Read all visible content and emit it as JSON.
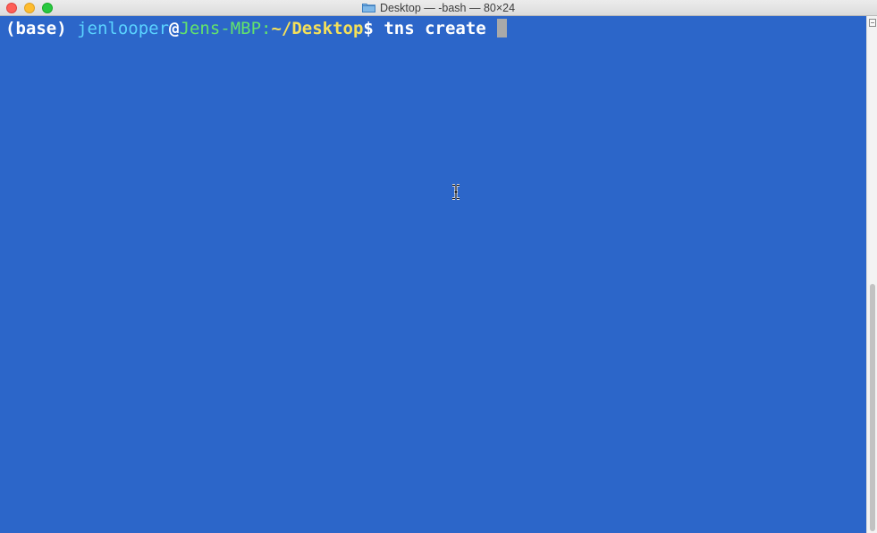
{
  "window": {
    "title": "Desktop — -bash — 80×24",
    "folder_icon": "folder-icon",
    "controls": [
      "close-button",
      "minimize-button",
      "zoom-button"
    ]
  },
  "terminal": {
    "background": "#2c66c9",
    "prompt": {
      "env": "(base)",
      "user": "jenlooper",
      "at": "@",
      "host": "Jens-MBP",
      "colon": ":",
      "path": "~/Desktop",
      "symbol": "$",
      "command": "tns create"
    },
    "colors": {
      "env": "#ffffff",
      "user": "#5ad3ff",
      "host": "#63e36b",
      "path": "#f4e05a",
      "command": "#ffffff"
    }
  }
}
